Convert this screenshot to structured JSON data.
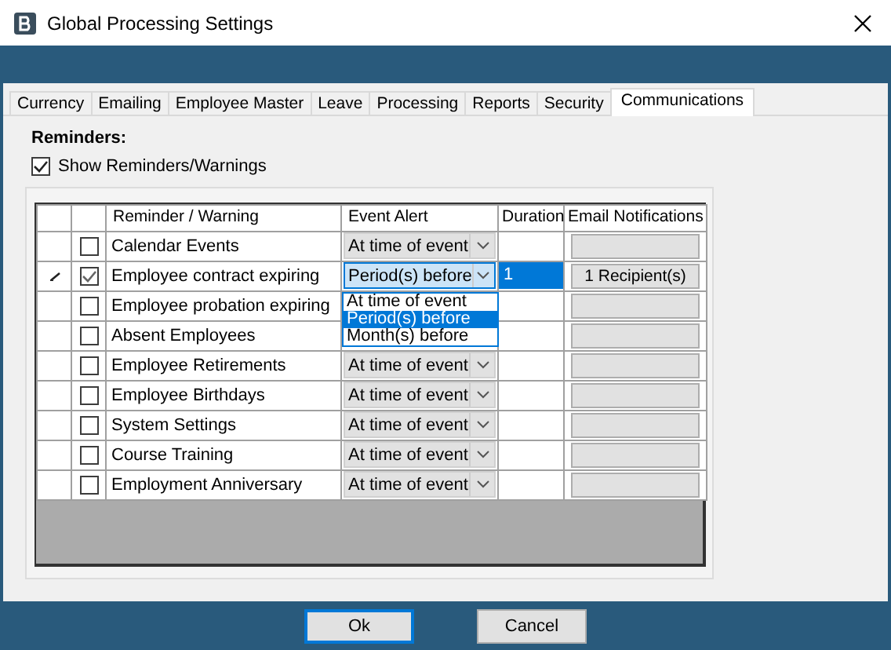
{
  "window": {
    "title": "Global Processing Settings"
  },
  "tabs": [
    {
      "label": "Currency",
      "selected": false
    },
    {
      "label": "Emailing",
      "selected": false
    },
    {
      "label": "Employee Master",
      "selected": false
    },
    {
      "label": "Leave",
      "selected": false
    },
    {
      "label": "Processing",
      "selected": false
    },
    {
      "label": "Reports",
      "selected": false
    },
    {
      "label": "Security",
      "selected": false
    },
    {
      "label": "Communications",
      "selected": true
    }
  ],
  "section_title": "Reminders:",
  "show_reminders": {
    "label": "Show Reminders/Warnings",
    "checked": true
  },
  "grid": {
    "columns": [
      "Reminder / Warning",
      "Event Alert",
      "Duration",
      "Email Notifications"
    ],
    "rows": [
      {
        "name": "Calendar Events",
        "checked": false,
        "editing": false,
        "event_alert": "At time of event"
      },
      {
        "name": "Employee contract expiring",
        "checked": true,
        "editing": true,
        "event_alert": "Period(s) before",
        "duration": "1",
        "duration_selected": true,
        "email": "1 Recipient(s)",
        "dropdown": [
          {
            "label": "At time of event",
            "selected": false
          },
          {
            "label": "Period(s) before",
            "selected": true
          },
          {
            "label": "Month(s) before",
            "selected": false
          }
        ]
      },
      {
        "name": "Employee probation expiring",
        "checked": false,
        "editing": false
      },
      {
        "name": "Absent Employees",
        "checked": false,
        "editing": false
      },
      {
        "name": "Employee Retirements",
        "checked": false,
        "editing": false,
        "event_alert": "At time of event"
      },
      {
        "name": "Employee Birthdays",
        "checked": false,
        "editing": false,
        "event_alert": "At time of event"
      },
      {
        "name": "System Settings",
        "checked": false,
        "editing": false,
        "event_alert": "At time of event"
      },
      {
        "name": "Course Training",
        "checked": false,
        "editing": false,
        "event_alert": "At time of event"
      },
      {
        "name": "Employment Anniversary",
        "checked": false,
        "editing": false,
        "event_alert": "At time of event"
      }
    ]
  },
  "buttons": [
    {
      "label": "Ok",
      "default": true
    },
    {
      "label": "Cancel",
      "default": false
    }
  ]
}
